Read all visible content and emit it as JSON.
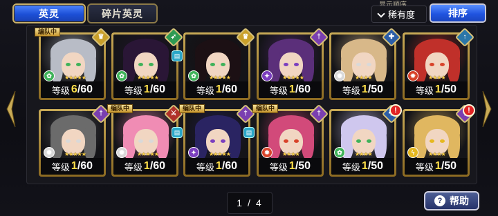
{
  "tabs": {
    "heroes": "英灵",
    "fragments": "碎片英灵"
  },
  "sort": {
    "label": "显示顺序",
    "value": "稀有度",
    "button": "排序"
  },
  "cards": [
    {
      "level_prefix": "等级",
      "level_current": "6",
      "level_max": "/60",
      "in_team": true,
      "team_label": "编队中",
      "element": "wind",
      "class": "crown",
      "book": false,
      "alert": false,
      "stars": 5,
      "hair": "#b8bcc6"
    },
    {
      "level_prefix": "等级",
      "level_current": "1",
      "level_max": "/60",
      "in_team": false,
      "team_label": "编队中",
      "element": "wind",
      "class": "bow",
      "book": true,
      "alert": false,
      "stars": 5,
      "hair": "#2a1636"
    },
    {
      "level_prefix": "等级",
      "level_current": "1",
      "level_max": "/60",
      "in_team": false,
      "team_label": "编队中",
      "element": "wind",
      "class": "crown",
      "book": false,
      "alert": false,
      "stars": 5,
      "hair": "#1c1014"
    },
    {
      "level_prefix": "等级",
      "level_current": "1",
      "level_max": "/60",
      "in_team": false,
      "team_label": "编队中",
      "element": "dark",
      "class": "sword",
      "book": false,
      "alert": false,
      "stars": 5,
      "hair": "#5b2f7a"
    },
    {
      "level_prefix": "等级",
      "level_current": "1",
      "level_max": "/50",
      "in_team": false,
      "team_label": "编队中",
      "element": "light",
      "class": "staff",
      "book": false,
      "alert": false,
      "stars": 4,
      "hair": "#d8b889"
    },
    {
      "level_prefix": "等级",
      "level_current": "1",
      "level_max": "/50",
      "in_team": false,
      "team_label": "编队中",
      "element": "fire",
      "class": "lance",
      "book": false,
      "alert": false,
      "stars": 4,
      "hair": "#c0302a"
    },
    {
      "level_prefix": "等级",
      "level_current": "1",
      "level_max": "/60",
      "in_team": false,
      "team_label": "编队中",
      "element": "light",
      "class": "sword",
      "book": false,
      "alert": false,
      "stars": 5,
      "hair": "#6b6b6b"
    },
    {
      "level_prefix": "等级",
      "level_current": "1",
      "level_max": "/60",
      "in_team": true,
      "team_label": "编队中",
      "element": "light",
      "class": "axe",
      "book": true,
      "alert": false,
      "stars": 5,
      "hair": "#f08cb4"
    },
    {
      "level_prefix": "等级",
      "level_current": "1",
      "level_max": "/60",
      "in_team": true,
      "team_label": "编队中",
      "element": "dark",
      "class": "sword",
      "book": true,
      "alert": false,
      "stars": 5,
      "hair": "#2a2462"
    },
    {
      "level_prefix": "等级",
      "level_current": "1",
      "level_max": "/50",
      "in_team": true,
      "team_label": "编队中",
      "element": "fire",
      "class": "sword",
      "book": false,
      "alert": false,
      "stars": 4,
      "hair": "#d24a7a"
    },
    {
      "level_prefix": "等级",
      "level_current": "1",
      "level_max": "/50",
      "in_team": false,
      "team_label": "编队中",
      "element": "wind",
      "class": "staff",
      "book": false,
      "alert": true,
      "stars": 4,
      "hair": "#cfc7ee"
    },
    {
      "level_prefix": "等级",
      "level_current": "1",
      "level_max": "/50",
      "in_team": false,
      "team_label": "编队中",
      "element": "thunder",
      "class": "sword",
      "book": false,
      "alert": true,
      "stars": 4,
      "hair": "#e0b760"
    }
  ],
  "pager": {
    "current": "1",
    "separator": "/",
    "total": "4"
  },
  "help": {
    "label": "帮助",
    "icon": "question-icon"
  },
  "colors": {
    "accent": "#2054e0",
    "gold": "#c9ab57",
    "level_value": "#ffe04a",
    "element_wind": "#3fb25a",
    "element_dark": "#7b3fbf",
    "element_light": "#d9d9d9",
    "element_fire": "#d8432a",
    "element_thunder": "#e6b81e"
  }
}
